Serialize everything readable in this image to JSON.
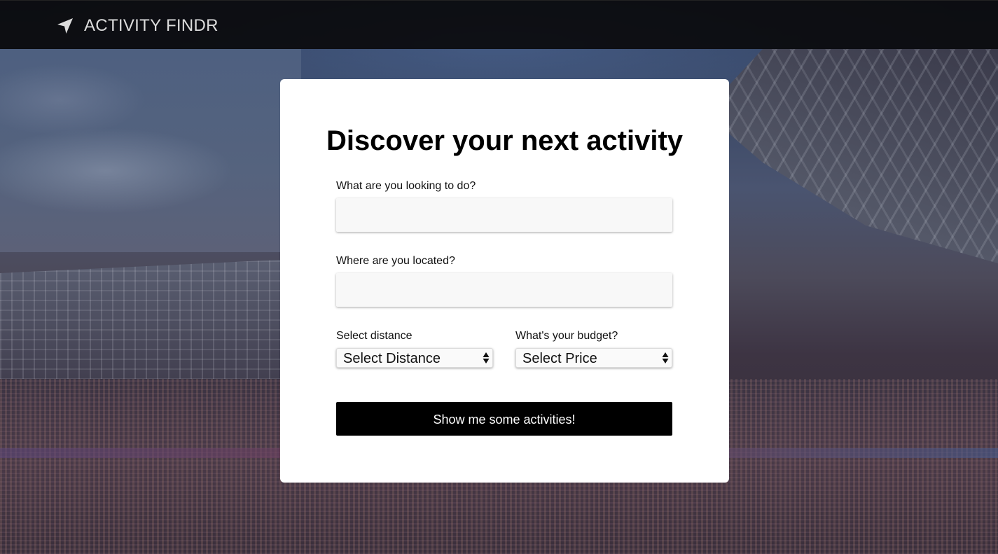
{
  "header": {
    "brand_icon": "location-arrow-icon",
    "brand_title": "ACTIVITY FINDR"
  },
  "card": {
    "title": "Discover your next activity",
    "activity_label": "What are you looking to do?",
    "activity_value": "",
    "location_label": "Where are you located?",
    "location_value": "",
    "distance_label": "Select distance",
    "distance_selected": "Select Distance",
    "budget_label": "What's your budget?",
    "budget_selected": "Select Price",
    "submit_label": "Show me some activities!"
  },
  "colors": {
    "header_bg": "#0a0a0c",
    "brand_text": "#dcdcdc",
    "card_bg": "#ffffff",
    "button_bg": "#000000",
    "button_text": "#ffffff",
    "input_bg": "#f8f8f8"
  }
}
